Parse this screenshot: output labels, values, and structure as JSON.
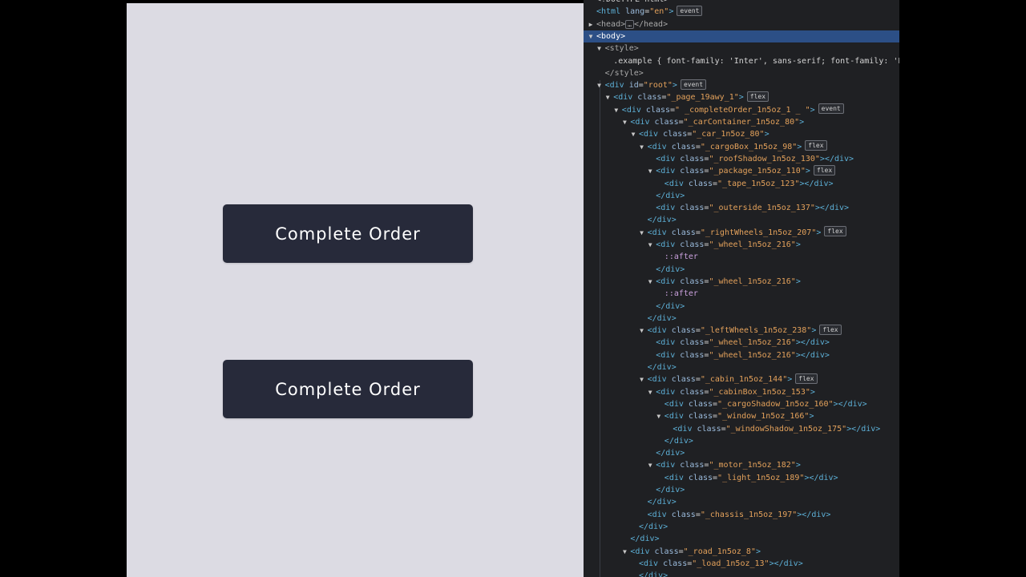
{
  "preview": {
    "buttons": [
      {
        "label": "Complete Order"
      },
      {
        "label": "Complete Order"
      }
    ]
  },
  "devtools": {
    "lines": [
      {
        "indent": 0,
        "arrow": "",
        "segments": [
          {
            "t": "text",
            "v": "<!DOCTYPE html>"
          }
        ]
      },
      {
        "indent": 0,
        "arrow": "",
        "segments": [
          {
            "t": "tag",
            "v": "<html "
          },
          {
            "t": "attr",
            "v": "lang"
          },
          {
            "t": "eq",
            "v": "="
          },
          {
            "t": "val",
            "v": "\"en\""
          },
          {
            "t": "tag",
            "v": ">"
          }
        ],
        "badge": "event"
      },
      {
        "indent": 0,
        "arrow": "right",
        "segments": [
          {
            "t": "punct",
            "v": "<head>"
          },
          {
            "t": "chip",
            "v": "…"
          },
          {
            "t": "punct",
            "v": "</head>"
          }
        ]
      },
      {
        "indent": 0,
        "arrow": "down",
        "selected": true,
        "segments": [
          {
            "t": "tag",
            "v": "<body>"
          }
        ]
      },
      {
        "indent": 1,
        "arrow": "down",
        "segments": [
          {
            "t": "punct",
            "v": "<style>"
          }
        ]
      },
      {
        "indent": 2,
        "arrow": "",
        "segments": [
          {
            "t": "text",
            "v": ".example { font-family: 'Inter', sans-serif; font-family: 'P"
          }
        ]
      },
      {
        "indent": 1,
        "arrow": "",
        "segments": [
          {
            "t": "punct",
            "v": "</style>"
          }
        ]
      },
      {
        "indent": 1,
        "arrow": "down",
        "segments": [
          {
            "t": "tag",
            "v": "<div "
          },
          {
            "t": "attr",
            "v": "id"
          },
          {
            "t": "eq",
            "v": "="
          },
          {
            "t": "val",
            "v": "\"root\""
          },
          {
            "t": "tag",
            "v": ">"
          }
        ],
        "badge": "event"
      },
      {
        "indent": 2,
        "arrow": "down",
        "segments": [
          {
            "t": "tag",
            "v": "<div "
          },
          {
            "t": "attr",
            "v": "class"
          },
          {
            "t": "eq",
            "v": "="
          },
          {
            "t": "val",
            "v": "\"_page_19awy_1\""
          },
          {
            "t": "tag",
            "v": ">"
          }
        ],
        "badge": "flex"
      },
      {
        "indent": 3,
        "arrow": "down",
        "segments": [
          {
            "t": "tag",
            "v": "<div "
          },
          {
            "t": "attr",
            "v": "class"
          },
          {
            "t": "eq",
            "v": "="
          },
          {
            "t": "val",
            "v": "\" _completeOrder_1n5oz_1 _ \""
          },
          {
            "t": "tag",
            "v": ">"
          }
        ],
        "badge": "event"
      },
      {
        "indent": 4,
        "arrow": "down",
        "segments": [
          {
            "t": "tag",
            "v": "<div "
          },
          {
            "t": "attr",
            "v": "class"
          },
          {
            "t": "eq",
            "v": "="
          },
          {
            "t": "val",
            "v": "\"_carContainer_1n5oz_80\""
          },
          {
            "t": "tag",
            "v": ">"
          }
        ]
      },
      {
        "indent": 5,
        "arrow": "down",
        "segments": [
          {
            "t": "tag",
            "v": "<div "
          },
          {
            "t": "attr",
            "v": "class"
          },
          {
            "t": "eq",
            "v": "="
          },
          {
            "t": "val",
            "v": "\"_car_1n5oz_80\""
          },
          {
            "t": "tag",
            "v": ">"
          }
        ]
      },
      {
        "indent": 6,
        "arrow": "down",
        "segments": [
          {
            "t": "tag",
            "v": "<div "
          },
          {
            "t": "attr",
            "v": "class"
          },
          {
            "t": "eq",
            "v": "="
          },
          {
            "t": "val",
            "v": "\"_cargoBox_1n5oz_98\""
          },
          {
            "t": "tag",
            "v": ">"
          }
        ],
        "badge": "flex"
      },
      {
        "indent": 7,
        "arrow": "",
        "segments": [
          {
            "t": "tag",
            "v": "<div "
          },
          {
            "t": "attr",
            "v": "class"
          },
          {
            "t": "eq",
            "v": "="
          },
          {
            "t": "val",
            "v": "\"_roofShadow_1n5oz_130\""
          },
          {
            "t": "tag",
            "v": "></div>"
          }
        ]
      },
      {
        "indent": 7,
        "arrow": "down",
        "segments": [
          {
            "t": "tag",
            "v": "<div "
          },
          {
            "t": "attr",
            "v": "class"
          },
          {
            "t": "eq",
            "v": "="
          },
          {
            "t": "val",
            "v": "\"_package_1n5oz_110\""
          },
          {
            "t": "tag",
            "v": ">"
          }
        ],
        "badge": "flex"
      },
      {
        "indent": 8,
        "arrow": "",
        "segments": [
          {
            "t": "tag",
            "v": "<div "
          },
          {
            "t": "attr",
            "v": "class"
          },
          {
            "t": "eq",
            "v": "="
          },
          {
            "t": "val",
            "v": "\"_tape_1n5oz_123\""
          },
          {
            "t": "tag",
            "v": "></div>"
          }
        ]
      },
      {
        "indent": 7,
        "arrow": "",
        "segments": [
          {
            "t": "tag",
            "v": "</div>"
          }
        ]
      },
      {
        "indent": 7,
        "arrow": "",
        "segments": [
          {
            "t": "tag",
            "v": "<div "
          },
          {
            "t": "attr",
            "v": "class"
          },
          {
            "t": "eq",
            "v": "="
          },
          {
            "t": "val",
            "v": "\"_outerside_1n5oz_137\""
          },
          {
            "t": "tag",
            "v": "></div>"
          }
        ]
      },
      {
        "indent": 6,
        "arrow": "",
        "segments": [
          {
            "t": "tag",
            "v": "</div>"
          }
        ]
      },
      {
        "indent": 6,
        "arrow": "down",
        "segments": [
          {
            "t": "tag",
            "v": "<div "
          },
          {
            "t": "attr",
            "v": "class"
          },
          {
            "t": "eq",
            "v": "="
          },
          {
            "t": "val",
            "v": "\"_rightWheels_1n5oz_207\""
          },
          {
            "t": "tag",
            "v": ">"
          }
        ],
        "badge": "flex"
      },
      {
        "indent": 7,
        "arrow": "down",
        "segments": [
          {
            "t": "tag",
            "v": "<div "
          },
          {
            "t": "attr",
            "v": "class"
          },
          {
            "t": "eq",
            "v": "="
          },
          {
            "t": "val",
            "v": "\"_wheel_1n5oz_216\""
          },
          {
            "t": "tag",
            "v": ">"
          }
        ]
      },
      {
        "indent": 8,
        "arrow": "",
        "segments": [
          {
            "t": "pseudo",
            "v": "::after"
          }
        ]
      },
      {
        "indent": 7,
        "arrow": "",
        "segments": [
          {
            "t": "tag",
            "v": "</div>"
          }
        ]
      },
      {
        "indent": 7,
        "arrow": "down",
        "segments": [
          {
            "t": "tag",
            "v": "<div "
          },
          {
            "t": "attr",
            "v": "class"
          },
          {
            "t": "eq",
            "v": "="
          },
          {
            "t": "val",
            "v": "\"_wheel_1n5oz_216\""
          },
          {
            "t": "tag",
            "v": ">"
          }
        ]
      },
      {
        "indent": 8,
        "arrow": "",
        "segments": [
          {
            "t": "pseudo",
            "v": "::after"
          }
        ]
      },
      {
        "indent": 7,
        "arrow": "",
        "segments": [
          {
            "t": "tag",
            "v": "</div>"
          }
        ]
      },
      {
        "indent": 6,
        "arrow": "",
        "segments": [
          {
            "t": "tag",
            "v": "</div>"
          }
        ]
      },
      {
        "indent": 6,
        "arrow": "down",
        "segments": [
          {
            "t": "tag",
            "v": "<div "
          },
          {
            "t": "attr",
            "v": "class"
          },
          {
            "t": "eq",
            "v": "="
          },
          {
            "t": "val",
            "v": "\"_leftWheels_1n5oz_238\""
          },
          {
            "t": "tag",
            "v": ">"
          }
        ],
        "badge": "flex"
      },
      {
        "indent": 7,
        "arrow": "",
        "segments": [
          {
            "t": "tag",
            "v": "<div "
          },
          {
            "t": "attr",
            "v": "class"
          },
          {
            "t": "eq",
            "v": "="
          },
          {
            "t": "val",
            "v": "\"_wheel_1n5oz_216\""
          },
          {
            "t": "tag",
            "v": "></div>"
          }
        ]
      },
      {
        "indent": 7,
        "arrow": "",
        "segments": [
          {
            "t": "tag",
            "v": "<div "
          },
          {
            "t": "attr",
            "v": "class"
          },
          {
            "t": "eq",
            "v": "="
          },
          {
            "t": "val",
            "v": "\"_wheel_1n5oz_216\""
          },
          {
            "t": "tag",
            "v": "></div>"
          }
        ]
      },
      {
        "indent": 6,
        "arrow": "",
        "segments": [
          {
            "t": "tag",
            "v": "</div>"
          }
        ]
      },
      {
        "indent": 6,
        "arrow": "down",
        "segments": [
          {
            "t": "tag",
            "v": "<div "
          },
          {
            "t": "attr",
            "v": "class"
          },
          {
            "t": "eq",
            "v": "="
          },
          {
            "t": "val",
            "v": "\"_cabin_1n5oz_144\""
          },
          {
            "t": "tag",
            "v": ">"
          }
        ],
        "badge": "flex"
      },
      {
        "indent": 7,
        "arrow": "down",
        "segments": [
          {
            "t": "tag",
            "v": "<div "
          },
          {
            "t": "attr",
            "v": "class"
          },
          {
            "t": "eq",
            "v": "="
          },
          {
            "t": "val",
            "v": "\"_cabinBox_1n5oz_153\""
          },
          {
            "t": "tag",
            "v": ">"
          }
        ]
      },
      {
        "indent": 8,
        "arrow": "",
        "segments": [
          {
            "t": "tag",
            "v": "<div "
          },
          {
            "t": "attr",
            "v": "class"
          },
          {
            "t": "eq",
            "v": "="
          },
          {
            "t": "val",
            "v": "\"_cargoShadow_1n5oz_160\""
          },
          {
            "t": "tag",
            "v": "></div>"
          }
        ]
      },
      {
        "indent": 8,
        "arrow": "down",
        "segments": [
          {
            "t": "tag",
            "v": "<div "
          },
          {
            "t": "attr",
            "v": "class"
          },
          {
            "t": "eq",
            "v": "="
          },
          {
            "t": "val",
            "v": "\"_window_1n5oz_166\""
          },
          {
            "t": "tag",
            "v": ">"
          }
        ]
      },
      {
        "indent": 9,
        "arrow": "",
        "segments": [
          {
            "t": "tag",
            "v": "<div "
          },
          {
            "t": "attr",
            "v": "class"
          },
          {
            "t": "eq",
            "v": "="
          },
          {
            "t": "val",
            "v": "\"_windowShadow_1n5oz_175\""
          },
          {
            "t": "tag",
            "v": "></div>"
          }
        ]
      },
      {
        "indent": 8,
        "arrow": "",
        "segments": [
          {
            "t": "tag",
            "v": "</div>"
          }
        ]
      },
      {
        "indent": 7,
        "arrow": "",
        "segments": [
          {
            "t": "tag",
            "v": "</div>"
          }
        ]
      },
      {
        "indent": 7,
        "arrow": "down",
        "segments": [
          {
            "t": "tag",
            "v": "<div "
          },
          {
            "t": "attr",
            "v": "class"
          },
          {
            "t": "eq",
            "v": "="
          },
          {
            "t": "val",
            "v": "\"_motor_1n5oz_182\""
          },
          {
            "t": "tag",
            "v": ">"
          }
        ]
      },
      {
        "indent": 8,
        "arrow": "",
        "segments": [
          {
            "t": "tag",
            "v": "<div "
          },
          {
            "t": "attr",
            "v": "class"
          },
          {
            "t": "eq",
            "v": "="
          },
          {
            "t": "val",
            "v": "\"_light_1n5oz_189\""
          },
          {
            "t": "tag",
            "v": "></div>"
          }
        ]
      },
      {
        "indent": 7,
        "arrow": "",
        "segments": [
          {
            "t": "tag",
            "v": "</div>"
          }
        ]
      },
      {
        "indent": 6,
        "arrow": "",
        "segments": [
          {
            "t": "tag",
            "v": "</div>"
          }
        ]
      },
      {
        "indent": 6,
        "arrow": "",
        "segments": [
          {
            "t": "tag",
            "v": "<div "
          },
          {
            "t": "attr",
            "v": "class"
          },
          {
            "t": "eq",
            "v": "="
          },
          {
            "t": "val",
            "v": "\"_chassis_1n5oz_197\""
          },
          {
            "t": "tag",
            "v": "></div>"
          }
        ]
      },
      {
        "indent": 5,
        "arrow": "",
        "segments": [
          {
            "t": "tag",
            "v": "</div>"
          }
        ]
      },
      {
        "indent": 4,
        "arrow": "",
        "segments": [
          {
            "t": "tag",
            "v": "</div>"
          }
        ]
      },
      {
        "indent": 4,
        "arrow": "down",
        "segments": [
          {
            "t": "tag",
            "v": "<div "
          },
          {
            "t": "attr",
            "v": "class"
          },
          {
            "t": "eq",
            "v": "="
          },
          {
            "t": "val",
            "v": "\"_road_1n5oz_8\""
          },
          {
            "t": "tag",
            "v": ">"
          }
        ]
      },
      {
        "indent": 5,
        "arrow": "",
        "segments": [
          {
            "t": "tag",
            "v": "<div "
          },
          {
            "t": "attr",
            "v": "class"
          },
          {
            "t": "eq",
            "v": "="
          },
          {
            "t": "val",
            "v": "\"_load_1n5oz_13\""
          },
          {
            "t": "tag",
            "v": "></div>"
          }
        ]
      },
      {
        "indent": 5,
        "arrow": "",
        "segments": [
          {
            "t": "tag",
            "v": "</div>"
          }
        ]
      }
    ]
  }
}
